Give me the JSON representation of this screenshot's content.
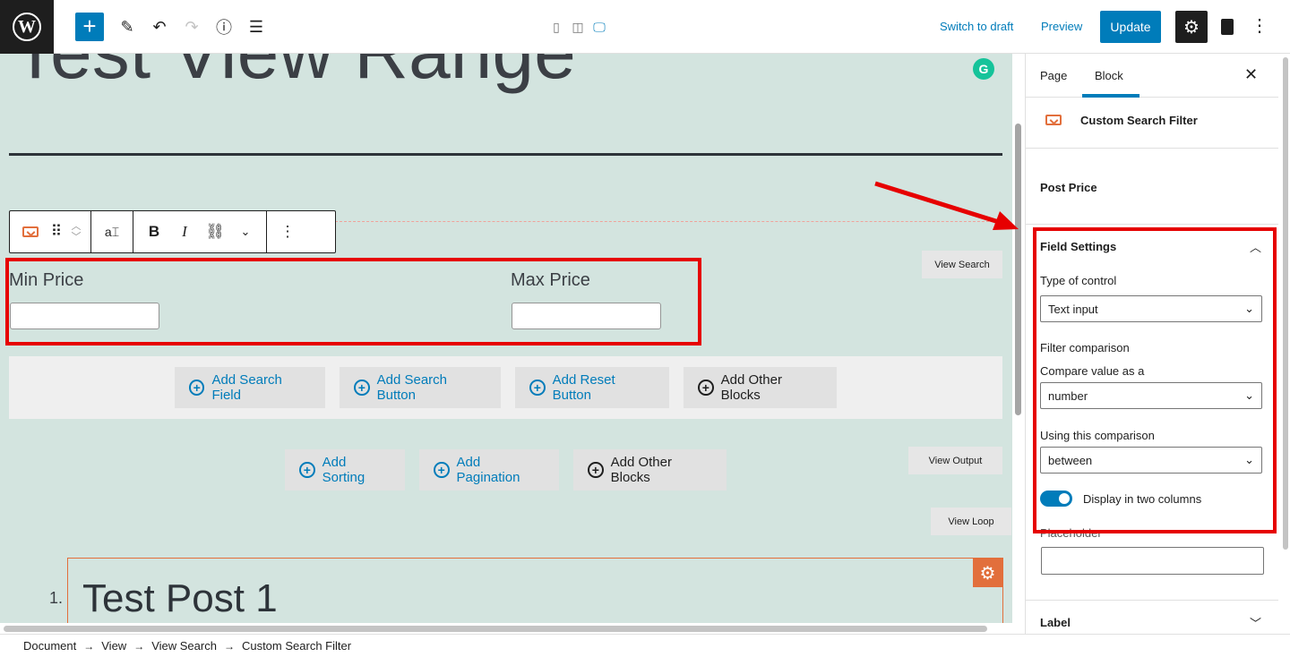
{
  "topbar": {
    "switch_to_draft": "Switch to draft",
    "preview": "Preview",
    "update": "Update",
    "colors": {
      "accent": "#007cba",
      "dark": "#1e1e1e"
    }
  },
  "canvas": {
    "page_title": "Test View Range",
    "grammarly": "G",
    "fields": {
      "min_label": "Min Price",
      "max_label": "Max Price",
      "min_value": "",
      "max_value": ""
    },
    "view_search": "View Search",
    "view_output": "View Output",
    "view_loop": "View Loop",
    "search_buttons": [
      "Add Search Field",
      "Add Search Button",
      "Add Reset Button",
      "Add Other Blocks"
    ],
    "output_buttons": [
      "Add Sorting",
      "Add Pagination",
      "Add Other Blocks"
    ],
    "loop": {
      "number": "1.",
      "post_title": "Test Post 1"
    },
    "colors": {
      "canvas_bg": "#d3e4df",
      "highlight": "#e60000",
      "block_accent": "#e26f3c"
    }
  },
  "sidebar": {
    "tabs": [
      "Page",
      "Block"
    ],
    "active_tab": "Block",
    "block_name": "Custom Search Filter",
    "post_price": "Post Price",
    "field_settings": {
      "title": "Field Settings",
      "type_of_control_label": "Type of control",
      "type_of_control_value": "Text input",
      "filter_comparison_label": "Filter comparison",
      "compare_as_label": "Compare value as a",
      "compare_as_value": "number",
      "using_comparison_label": "Using this comparison",
      "using_comparison_value": "between",
      "two_columns_label": "Display in two columns",
      "two_columns_on": true,
      "placeholder_label": "Placeholder"
    },
    "label_panel": "Label"
  },
  "breadcrumb": [
    "Document",
    "View",
    "View Search",
    "Custom Search Filter"
  ]
}
